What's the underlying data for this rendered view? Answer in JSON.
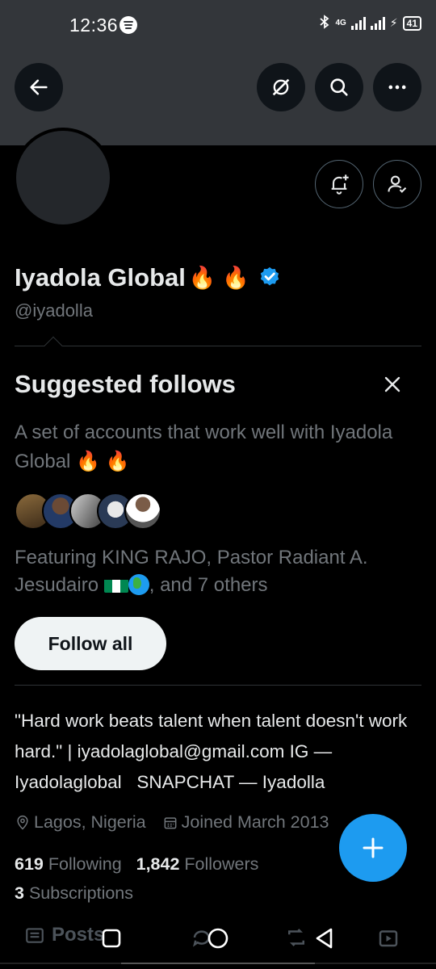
{
  "status_bar": {
    "time": "12:36",
    "network": "4G",
    "battery": "41"
  },
  "header": {
    "back_icon": "arrow-left-icon",
    "grok_icon": "grok-icon",
    "search_icon": "search-icon",
    "more_icon": "more-icon"
  },
  "profile": {
    "name": "Iyadola Global",
    "name_emoji": "🔥 🔥",
    "handle": "@iyadolla",
    "verified": true,
    "bio": "\"Hard work beats talent when talent doesn't work hard.\" | iyadolaglobal@gmail.com IG — Iyadolaglobal   SNAPCHAT — Iyadolla",
    "location": "Lagos, Nigeria",
    "joined": "Joined March 2013",
    "following_count": "619",
    "following_label": "Following",
    "followers_count": "1,842",
    "followers_label": "Followers",
    "subscriptions_count": "3",
    "subscriptions_label": "Subscriptions"
  },
  "suggested": {
    "title": "Suggested follows",
    "description": "A set of accounts that work well with Iyadola Global",
    "description_emoji": "🔥 🔥",
    "featuring_prefix": "Featuring KING RAJO, Pastor Radiant A. Jesudairo",
    "featuring_suffix": ", and 7 others",
    "follow_all_label": "Follow all"
  },
  "tabs": {
    "posts_label": "Posts"
  },
  "colors": {
    "accent": "#1d9bf0",
    "background": "#000000",
    "banner": "#33363a",
    "muted_text": "#71767b"
  }
}
